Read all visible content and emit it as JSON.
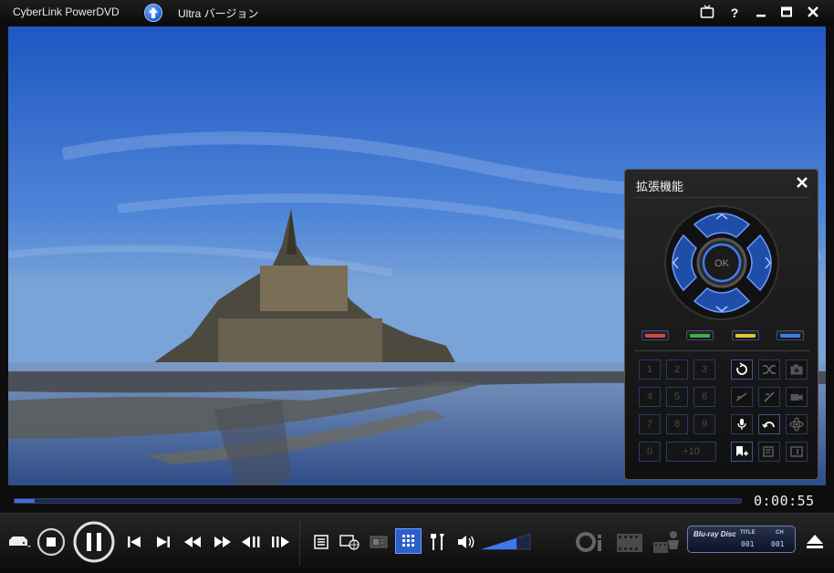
{
  "titlebar": {
    "app_title": "CyberLink PowerDVD",
    "upgrade_label": "Ultra バージョン"
  },
  "panel": {
    "title": "拡張機能",
    "ok_label": "OK",
    "numbers": [
      "1",
      "2",
      "3",
      "4",
      "5",
      "6",
      "7",
      "8",
      "9",
      "0"
    ],
    "plus_ten": "+10",
    "color_keys": [
      "#d24545",
      "#3fae48",
      "#e0c53a",
      "#3d7ee6"
    ]
  },
  "playback": {
    "time": "0:00:55",
    "progress_fraction": 0.028
  },
  "volume": {
    "level_fraction": 0.72
  },
  "disc_info": {
    "logo": "Blu-ray Disc",
    "title_label": "TITLE",
    "title_value": "001",
    "chapter_label": "CH",
    "chapter_value": "001"
  },
  "colors": {
    "accent": "#3c6fd9",
    "active_button": "#2d5fc8"
  }
}
